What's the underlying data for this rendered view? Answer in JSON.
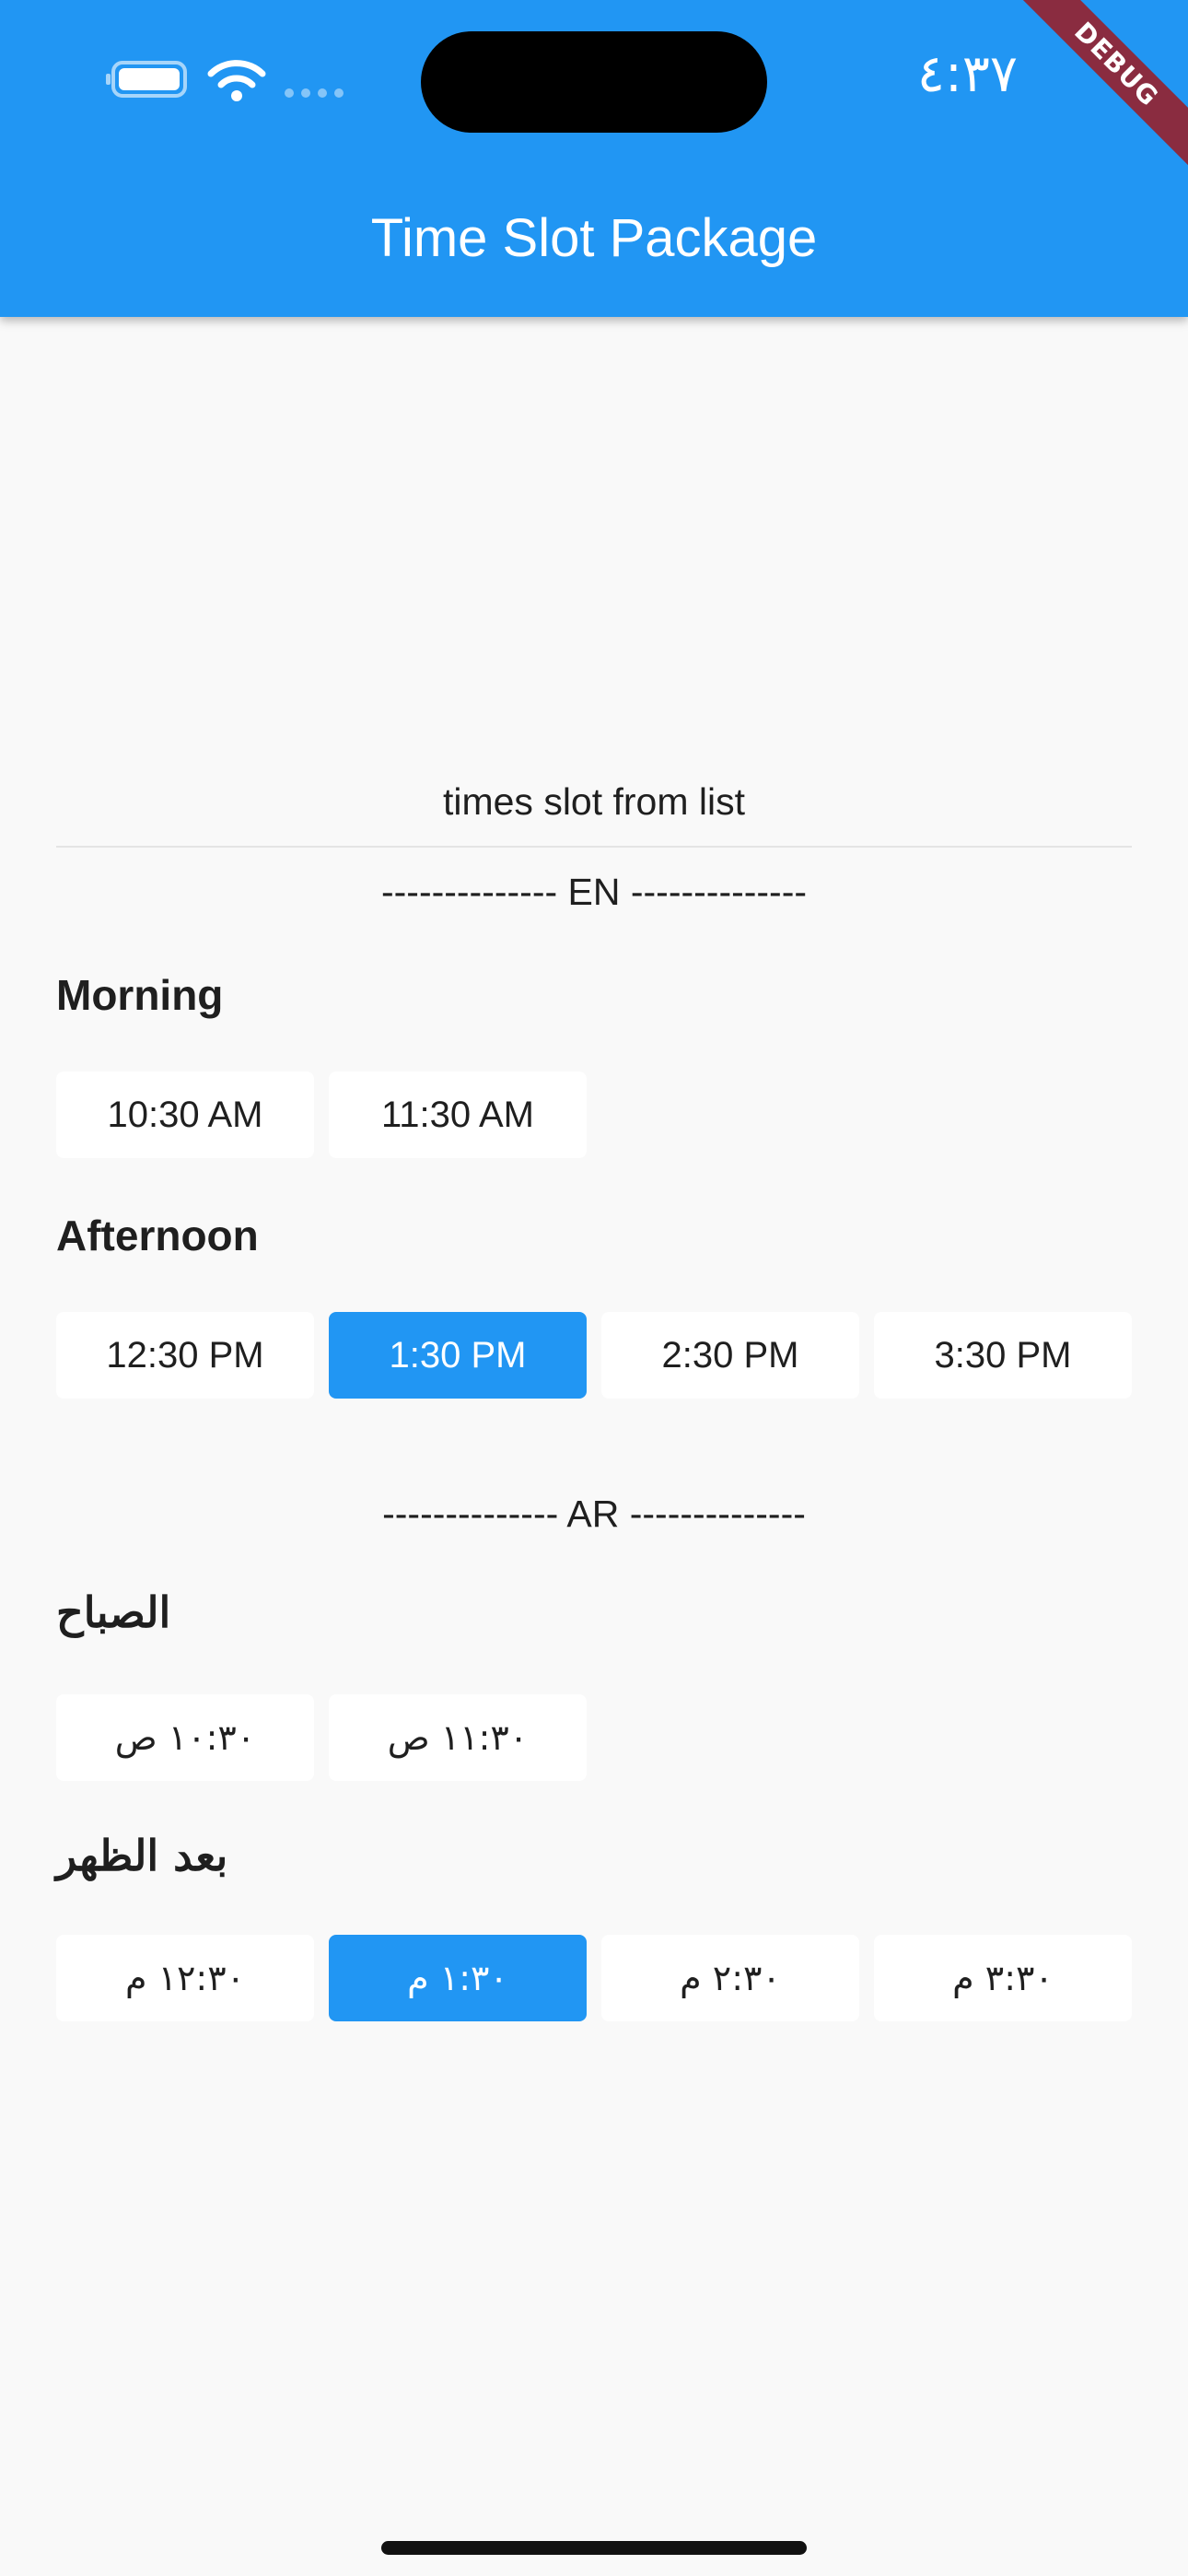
{
  "status_bar": {
    "time": "٤:٣٧"
  },
  "app_bar": {
    "title": "Time Slot Package",
    "debug_banner": "DEBUG",
    "color": "#2196f3"
  },
  "content": {
    "caption": "times slot from list",
    "en": {
      "separator": "-------------- EN --------------",
      "groups": [
        {
          "title": "Morning",
          "slots": [
            "10:30 AM",
            "11:30 AM"
          ]
        },
        {
          "title": "Afternoon",
          "slots": [
            "12:30 PM",
            "1:30 PM",
            "2:30 PM",
            "3:30 PM"
          ],
          "selected": "1:30 PM"
        }
      ]
    },
    "ar": {
      "separator": "-------------- AR --------------",
      "groups": [
        {
          "title": "الصباح",
          "slots": [
            "١٠:٣٠ ص",
            "١١:٣٠ ص"
          ]
        },
        {
          "title": "بعد الظهر",
          "slots": [
            "١٢:٣٠ م",
            "١:٣٠ م",
            "٢:٣٠ م",
            "٣:٣٠ م"
          ],
          "selected": "١:٣٠ م"
        }
      ]
    }
  },
  "icons": [
    "battery-icon",
    "wifi-icon",
    "cellular-signal-icon"
  ]
}
